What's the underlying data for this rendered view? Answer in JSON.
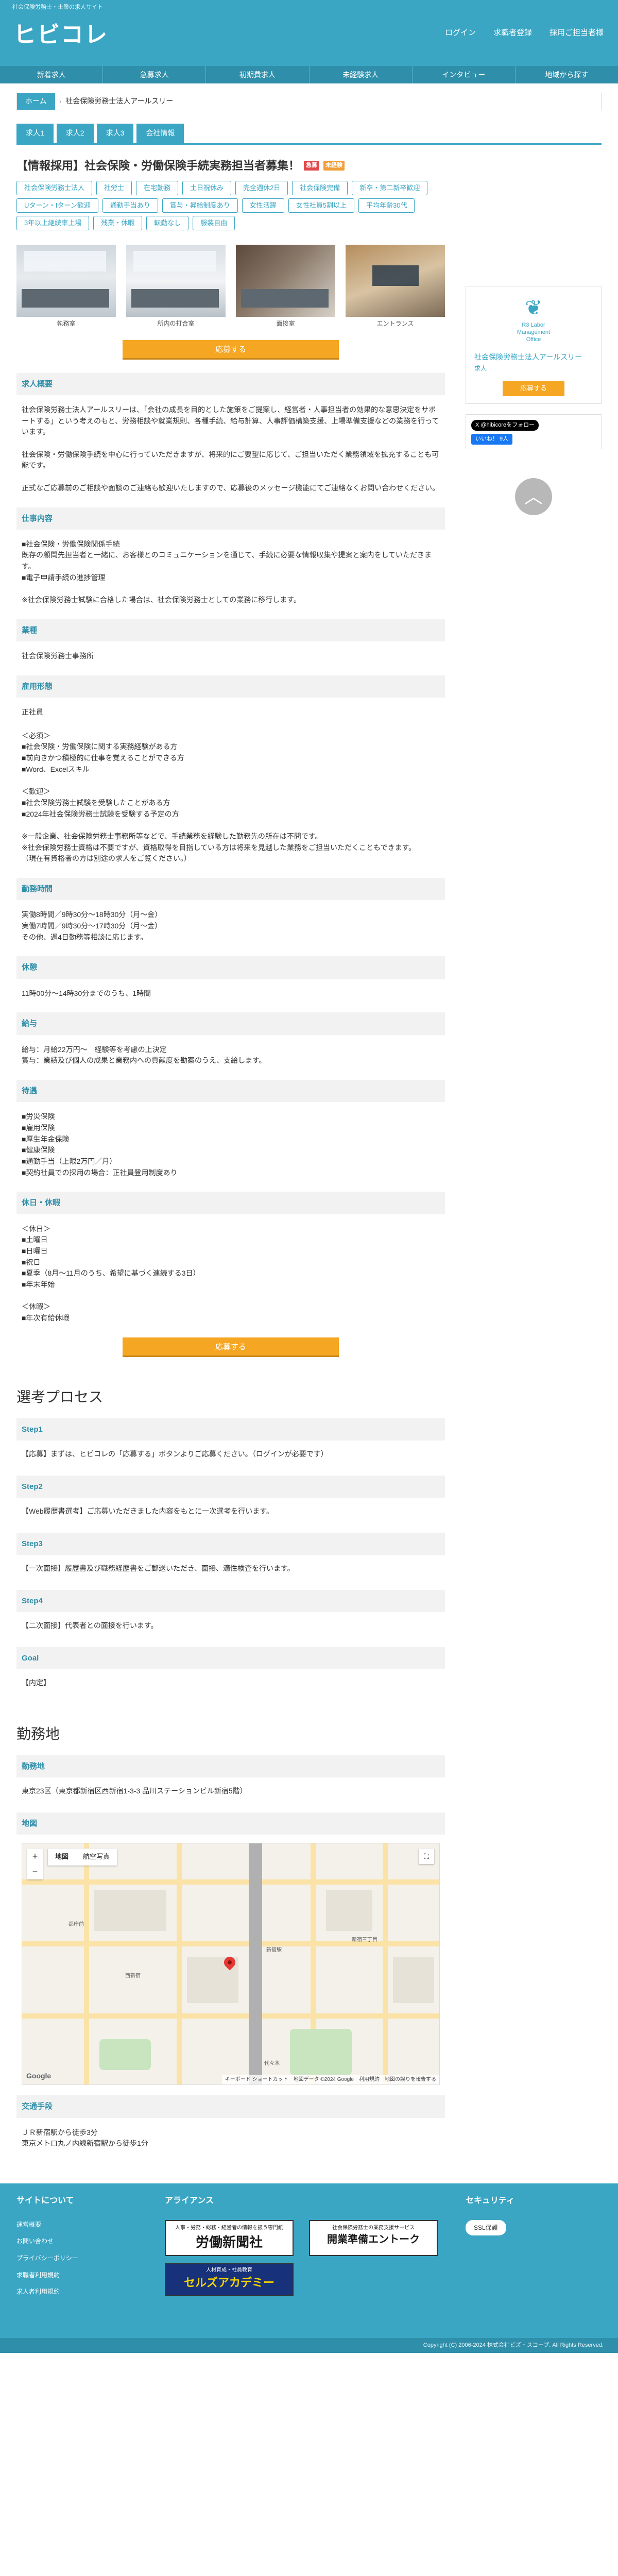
{
  "header": {
    "tagline": "社会保険労務士・士業の求人サイト",
    "logo": "ヒビコレ",
    "links": [
      "ログイン",
      "求職者登録",
      "採用ご担当者様"
    ]
  },
  "nav": [
    "新着求人",
    "急募求人",
    "初期費求人",
    "未経験求人",
    "インタビュー",
    "地域から探す"
  ],
  "breadcrumb": {
    "home": "ホーム",
    "sep": "›",
    "current": "社会保険労務士法人アールスリー"
  },
  "tabs": [
    "求人1",
    "求人2",
    "求人3",
    "会社情報"
  ],
  "job": {
    "title": "【情報採用】社会保険・労働保険手続実務担当者募集！",
    "badges": [
      "急募",
      "未経験"
    ],
    "tags": [
      "社会保険労務士法人",
      "社労士",
      "在宅勤務",
      "土日祝休み",
      "完全週休2日",
      "社会保険完備",
      "新卒・第二新卒歓迎",
      "Uターン・Iターン歓迎",
      "通勤手当あり",
      "賞与・昇給制度あり",
      "女性活躍",
      "女性社員5割以上",
      "平均年齢30代",
      "3年以上継続率上場",
      "残業・休暇",
      "転勤なし",
      "服装自由"
    ],
    "photos": [
      "執務室",
      "所内の打合室",
      "面接室",
      "エントランス"
    ],
    "apply_label": "応募する"
  },
  "sections": [
    {
      "title": "求人概要",
      "body": "社会保険労務士法人アールスリーは、「会社の成長を目的とした施策をご提案し、経営者・人事担当者の効果的な意思決定をサポートする」という考えのもと、労務相談や就業規則、各種手続、給与計算、人事評価構築支援、上場準備支援などの業務を行っています。\n\n社会保険・労働保険手続を中心に行っていただきますが、将来的にご要望に応じて、ご担当いただく業務領域を拡充することも可能です。\n\n正式なご応募前のご相談や面談のご連絡も歓迎いたしますので、応募後のメッセージ機能にてご連絡なくお問い合わせください。"
    },
    {
      "title": "仕事内容",
      "body": "■社会保険・労働保険関係手続\n既存の顧問先担当者と一緒に、お客様とのコミュニケーションを通じて、手続に必要な情報収集や提案と案内をしていただきます。\n■電子申請手続の進捗管理\n\n※社会保険労務士試験に合格した場合は、社会保険労務士としての業務に移行します。"
    },
    {
      "title": "業種",
      "body": "社会保険労務士事務所"
    },
    {
      "title": "雇用形態",
      "body": "正社員"
    },
    {
      "title": "",
      "body": "＜必須＞\n■社会保険・労働保険に関する実務経験がある方\n■前向きかつ積極的に仕事を覚えることができる方\n■Word、Excelスキル\n\n＜歓迎＞\n■社会保険労務士試験を受験したことがある方\n■2024年社会保険労務士試験を受験する予定の方\n\n※一般企業、社会保険労務士事務所等などで、手続業務を経験した勤務先の所在は不問です。\n※社会保険労務士資格は不要ですが、資格取得を目指している方は将来を見越した業務をご担当いただくこともできます。\n（現在有資格者の方は別途の求人をご覧ください。）"
    },
    {
      "title": "勤務時間",
      "body": "実働8時間／9時30分〜18時30分（月〜金）\n実働7時間／9時30分〜17時30分（月〜金）\nその他、週4日勤務等相談に応じます。"
    },
    {
      "title": "休憩",
      "body": "11時00分〜14時30分までのうち、1時間"
    },
    {
      "title": "給与",
      "body": "給与：月給22万円〜　経験等を考慮の上決定\n賞与：業績及び個人の成果と業務内への貢献度を勘案のうえ、支給します。"
    },
    {
      "title": "待遇",
      "body": "■労災保険\n■雇用保険\n■厚生年金保険\n■健康保険\n■通勤手当（上限2万円／月）\n■契約社員での採用の場合：正社員登用制度あり"
    },
    {
      "title": "休日・休暇",
      "body": "＜休日＞\n■土曜日\n■日曜日\n■祝日\n■夏季（8月〜11月のうち、希望に基づく連続する3日）\n■年末年始\n\n＜休暇＞\n■年次有給休暇"
    }
  ],
  "process": {
    "heading": "選考プロセス",
    "steps": [
      {
        "title": "Step1",
        "body": "【応募】まずは、ヒビコレの「応募する」ボタンよりご応募ください。（ログインが必要です）"
      },
      {
        "title": "Step2",
        "body": "【Web履歴書選考】ご応募いただきました内容をもとに一次選考を行います。"
      },
      {
        "title": "Step3",
        "body": "【一次面接】履歴書及び職務経歴書をご郵送いただき、面接、適性検査を行います。"
      },
      {
        "title": "Step4",
        "body": "【二次面接】代表者との面接を行います。"
      },
      {
        "title": "Goal",
        "body": "【内定】"
      }
    ]
  },
  "location": {
    "heading": "勤務地",
    "address_title": "勤務地",
    "address": "東京23区（東京都新宿区西新宿1-3-3 品川ステーションビル新宿5階）",
    "map_title": "地図",
    "map_buttons": [
      "地図",
      "航空写真"
    ],
    "map_zoom": [
      "+",
      "−"
    ],
    "map_fullscreen": "⛶",
    "map_logo": "Google",
    "map_credits": "キーボード ショートカット　地図データ ©2024 Google　利用規約　地図の誤りを報告する",
    "map_labels": [
      "新宿駅",
      "西新宿",
      "都庁前",
      "新宿三丁目",
      "代々木"
    ],
    "access_title": "交通手段",
    "access": "ＪＲ新宿駅から徒歩3分\n東京メトロ丸ノ内線新宿駅から徒歩1分"
  },
  "sidebar": {
    "logo_text": "R3 Labor\nManagement\nOffice",
    "company_name": "社会保険労務士法人アールスリー",
    "company_sub": "求人",
    "apply_label": "応募する",
    "x_label": "X @hibicoreをフォロー",
    "fb_label": "いいね！ 9人",
    "totop": "︿"
  },
  "footer": {
    "about_title": "サイトについて",
    "about_links": [
      "運営概要",
      "お問い合わせ",
      "プライバシーポリシー",
      "求職者利用規約",
      "求人者利用規約"
    ],
    "alliance_title": "アライアンス",
    "ads": [
      {
        "sub": "人事・労務・総務・経営者の情報を扱う専門紙",
        "name": "労働新聞社"
      },
      {
        "sub": "社会保険労務士の業務支援サービス",
        "name": "開業準備エントーク"
      },
      {
        "sub": "人材育成・社員教育",
        "name": "セルズアカデミー"
      }
    ],
    "security_title": "セキュリティ",
    "security_badge": "SSL保護"
  },
  "copyright": "Copyright (C) 2006-2024 株式会社ビズ・スコープ. All Rights Reserved."
}
